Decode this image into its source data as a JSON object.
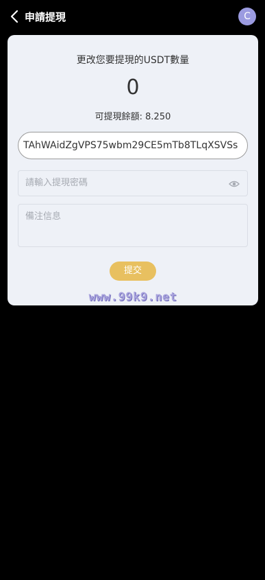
{
  "header": {
    "title": "申請提現",
    "avatar_letter": "C"
  },
  "form": {
    "prompt": "更改您要提現的USDT數量",
    "amount": "0",
    "balance_label": "可提現餘額:",
    "balance_value": "8.250",
    "address": "TAhWAidZgVPS75wbm29CE5mTb8TLqXSVSs",
    "password_placeholder": "請輸入提現密碼",
    "remark_placeholder": "備注信息",
    "submit_label": "提交"
  },
  "watermark": "www.99k9.net",
  "colors": {
    "background": "#000000",
    "card": "#eef1f7",
    "accent": "#e8c060",
    "avatar": "#9b9be0"
  }
}
